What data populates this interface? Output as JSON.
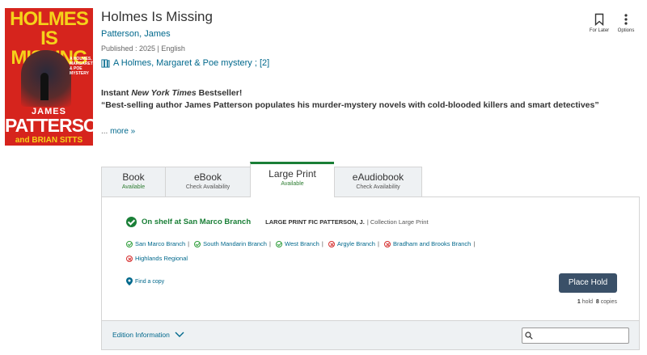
{
  "cover": {
    "title": "HOLMES IS MISSING",
    "series_text": "A HOLMES, MARGARET & POE MYSTERY",
    "author_first": "JAMES",
    "author_last": "PATTERSON",
    "coauthor": "and BRIAN SITTS"
  },
  "book": {
    "title": "Holmes Is Missing",
    "author": "Patterson, James",
    "published": "Published : 2025 | English",
    "series": "A Holmes, Margaret & Poe mystery ; [2]"
  },
  "description": {
    "line1_prefix": "Instant ",
    "line1_em": "New York Times",
    "line1_suffix": " Bestseller!",
    "line2": "“Best-selling author James Patterson populates his murder-mystery novels with cold-blooded killers and smart detectives”",
    "ellipsis": "... ",
    "more_link": "more »"
  },
  "actions": {
    "for_later": "For Later",
    "options": "Options"
  },
  "tabs": [
    {
      "label": "Book",
      "status": "Available"
    },
    {
      "label": "eBook",
      "status": "Check Availability"
    },
    {
      "label": "Large Print",
      "status": "Available"
    },
    {
      "label": "eAudiobook",
      "status": "Check Availability"
    }
  ],
  "availability": {
    "status": "On shelf at San Marco Branch",
    "call_number": "LARGE PRINT FIC PATTERSON, J.",
    "collection": "| Collection Large Print",
    "branches": [
      {
        "name": "San Marco Branch",
        "available": true
      },
      {
        "name": "South Mandarin Branch",
        "available": true
      },
      {
        "name": "West Branch",
        "available": true
      },
      {
        "name": "Argyle Branch",
        "available": false
      },
      {
        "name": "Bradham and Brooks Branch",
        "available": false
      },
      {
        "name": "Highlands Regional",
        "available": false
      }
    ],
    "find_copy": "Find a copy",
    "place_hold": "Place Hold",
    "holds_count": "1",
    "holds_label": "hold",
    "copies_count": "8",
    "copies_label": "copies"
  },
  "edition": {
    "label": "Edition Information",
    "search_placeholder": ""
  },
  "colors": {
    "link": "#00688c",
    "available": "#1a7f37",
    "unavailable": "#d63030",
    "hold_button": "#3a5068",
    "cover_red": "#d6241d",
    "cover_yellow": "#f5d21a"
  }
}
